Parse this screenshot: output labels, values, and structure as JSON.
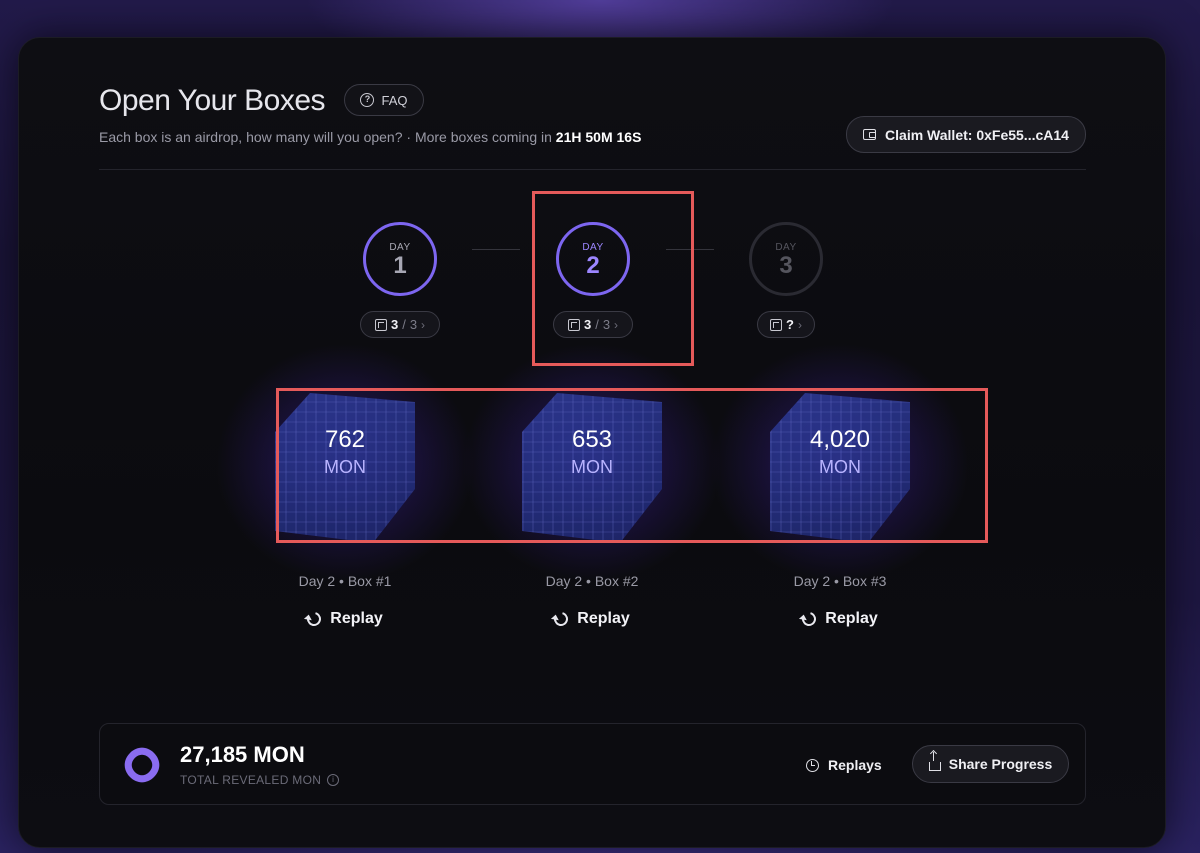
{
  "header": {
    "title": "Open Your Boxes",
    "faq_label": "FAQ",
    "subtitle_prefix": "Each box is an airdrop, how many will you open? · More boxes coming in",
    "countdown": "21H 50M 16S",
    "claim_wallet_label": "Claim Wallet: 0xFe55...cA14"
  },
  "days": [
    {
      "label": "DAY",
      "number": "1",
      "opened": "3",
      "separator": "/",
      "total": "3",
      "state": "completed"
    },
    {
      "label": "DAY",
      "number": "2",
      "opened": "3",
      "separator": "/",
      "total": "3",
      "state": "active"
    },
    {
      "label": "DAY",
      "number": "3",
      "opened": "?",
      "separator": "",
      "total": "",
      "state": "locked"
    }
  ],
  "boxes": [
    {
      "value": "762",
      "unit": "MON",
      "caption": "Day 2 • Box #1",
      "replay_label": "Replay"
    },
    {
      "value": "653",
      "unit": "MON",
      "caption": "Day 2 • Box #2",
      "replay_label": "Replay"
    },
    {
      "value": "4,020",
      "unit": "MON",
      "caption": "Day 2 • Box #3",
      "replay_label": "Replay"
    }
  ],
  "footer": {
    "total_value": "27,185 MON",
    "total_label": "TOTAL REVEALED MON",
    "replays_label": "Replays",
    "share_label": "Share Progress"
  },
  "colors": {
    "accent": "#7d66f0",
    "highlight": "#e55a5a",
    "background": "#0b0b0f"
  }
}
